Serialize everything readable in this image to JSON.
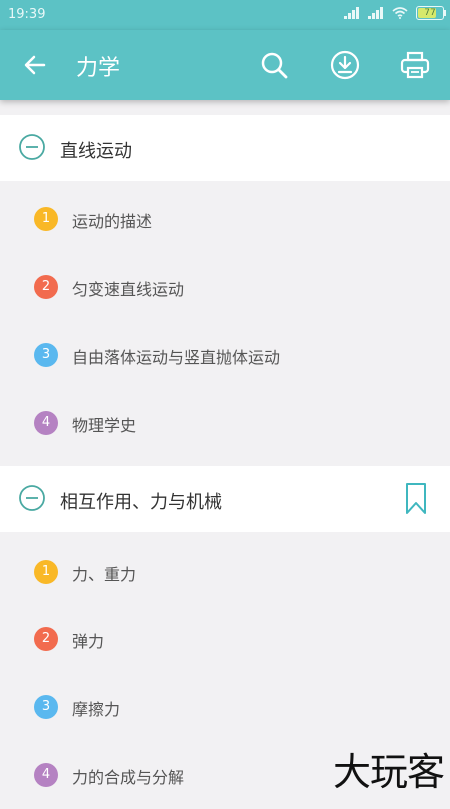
{
  "status": {
    "time": "19:39",
    "battery": "77"
  },
  "header": {
    "title": "力学"
  },
  "colors": {
    "teal": "#5cc2c5",
    "badge1": "#f9b827",
    "badge2": "#f26b4e",
    "badge3": "#5ab8ef",
    "badge4": "#b582c2"
  },
  "sections": [
    {
      "label": "直线运动",
      "items": [
        {
          "num": "1",
          "label": "运动的描述"
        },
        {
          "num": "2",
          "label": "匀变速直线运动"
        },
        {
          "num": "3",
          "label": "自由落体运动与竖直抛体运动"
        },
        {
          "num": "4",
          "label": "物理学史"
        }
      ]
    },
    {
      "label": "相互作用、力与机械",
      "items": [
        {
          "num": "1",
          "label": "力、重力"
        },
        {
          "num": "2",
          "label": "弹力"
        },
        {
          "num": "3",
          "label": "摩擦力"
        },
        {
          "num": "4",
          "label": "力的合成与分解"
        }
      ]
    }
  ],
  "watermark": "大玩客"
}
